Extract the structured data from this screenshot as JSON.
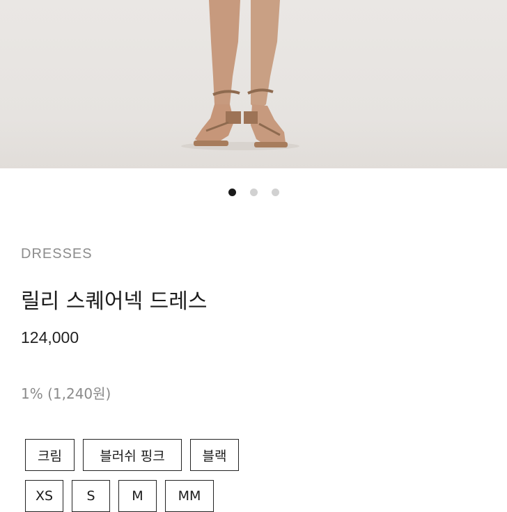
{
  "product": {
    "category": "DRESSES",
    "name": "릴리 스퀘어넥 드레스",
    "price": "124,000",
    "points": "1% (1,240원)"
  },
  "gallery": {
    "image": "product-photo-legs-sandals",
    "dots_total": 3,
    "active_dot": 1
  },
  "options": {
    "colors": [
      "크림",
      "블러쉬 핑크",
      "블랙"
    ],
    "sizes": [
      "XS",
      "S",
      "M",
      "MM"
    ]
  },
  "colors": {
    "text": "#1a1a1a",
    "muted": "#8c8c8c",
    "dot_inactive": "#d1d1d1"
  }
}
